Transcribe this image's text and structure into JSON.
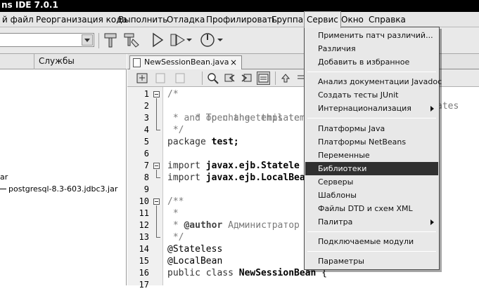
{
  "window": {
    "title": "ns IDE 7.0.1"
  },
  "menubar": {
    "items": [
      "й файл",
      "Реорганизация кода",
      "Выполнить",
      "Отладка",
      "Профилировать",
      "Группа",
      "Сервис",
      "Окно",
      "Справка"
    ],
    "active_index": 6
  },
  "left_panel": {
    "services_tab": "Службы",
    "tree_items": [
      "ar",
      "postgresql-8.3-603.jdbc3.jar"
    ]
  },
  "editor": {
    "tab_title": "NewSessionBean.java",
    "tab_close": "×",
    "line_numbers": [
      "1",
      "2",
      "3",
      "4",
      "5",
      "6",
      "7",
      "8",
      "9",
      "10",
      "11",
      "12",
      "13",
      "14",
      "15",
      "16",
      "17"
    ],
    "lines": [
      "/*",
      " * To change this template, choose Tools | Templates",
      " * and open the template in the editor.",
      " */",
      "package test;",
      "",
      "import javax.ejb.Stateless;",
      "import javax.ejb.LocalBean;",
      "",
      "/**",
      " *",
      " * @author Администратор",
      " */",
      "@Stateless",
      "@LocalBean",
      "public class NewSessionBean {",
      ""
    ],
    "code": {
      "l1": "/*",
      "l2": " * To change this templ",
      "l2_tail": "ates",
      "l3": " * and open the template",
      "l4": " */",
      "l5_kw": "package",
      "l5_rest": " test;",
      "l7_kw": "import",
      "l7_rest": " javax.ejb.Statele",
      "l8_kw": "import",
      "l8_rest": " javax.ejb.LocalBea",
      "l10": "/**",
      "l11": " *",
      "l12_a": " * ",
      "l12_tag": "@author",
      "l12_b": " Администратор",
      "l13": " */",
      "l14": "@Stateless",
      "l15": "@LocalBean",
      "l16_kw": "public class",
      "l16_name": "NewSessionBean",
      "l16_rest": " {"
    }
  },
  "service_menu": {
    "items": [
      "Применить патч различий...",
      "Различия",
      "Добавить в избранное",
      "Анализ документации Javadoc",
      "Создать тесты JUnit",
      "Интернационализация",
      "Платформы Java",
      "Платформы NetBeans",
      "Переменные",
      "Библиотеки",
      "Серверы",
      "Шаблоны",
      "Файлы DTD и схем XML",
      "Палитра",
      "Подключаемые модули",
      "Параметры"
    ],
    "highlighted": "Библиотеки",
    "with_submenu": [
      "Интернационализация",
      "Палитра"
    ]
  },
  "colors": {
    "menu_highlight": "#303030",
    "titlebar": "#000000"
  }
}
